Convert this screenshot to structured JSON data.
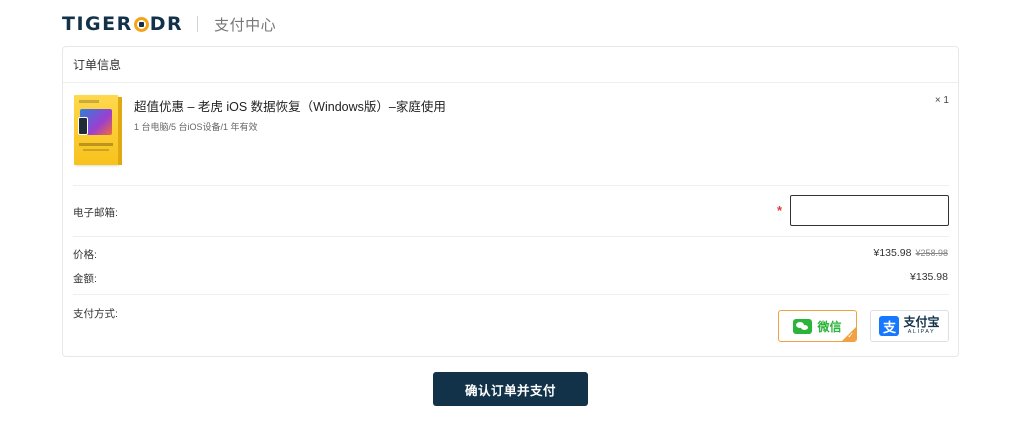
{
  "header": {
    "logo_left": "TIGER",
    "logo_right": "DR",
    "title": "支付中心"
  },
  "order": {
    "section_title": "订单信息",
    "product": {
      "name": "超值优惠 – 老虎 iOS 数据恢复（Windows版）–家庭使用",
      "description": "1 台电脑/5 台iOS设备/1 年有效",
      "quantity": "× 1",
      "image_icon": "ios-data-recovery-box"
    },
    "email": {
      "label": "电子邮箱:",
      "required_mark": "*",
      "value": "",
      "placeholder": ""
    },
    "price": {
      "label": "价格:",
      "current": "¥135.98",
      "original": "¥258.98"
    },
    "amount": {
      "label": "金额:",
      "value": "¥135.98"
    },
    "payment": {
      "label": "支付方式:",
      "selected": "wechat",
      "options": {
        "wechat": {
          "label": "微信",
          "icon": "wechat-icon",
          "color": "#2bb43a"
        },
        "alipay": {
          "label": "支付宝",
          "sublabel": "ALIPAY",
          "icon": "alipay-icon",
          "color": "#1677ff"
        }
      }
    }
  },
  "confirm_button": "确认订单并支付",
  "colors": {
    "brand": "#12324a",
    "accent": "#f5a418",
    "selected_border": "#f0a242",
    "required": "#e53935"
  }
}
